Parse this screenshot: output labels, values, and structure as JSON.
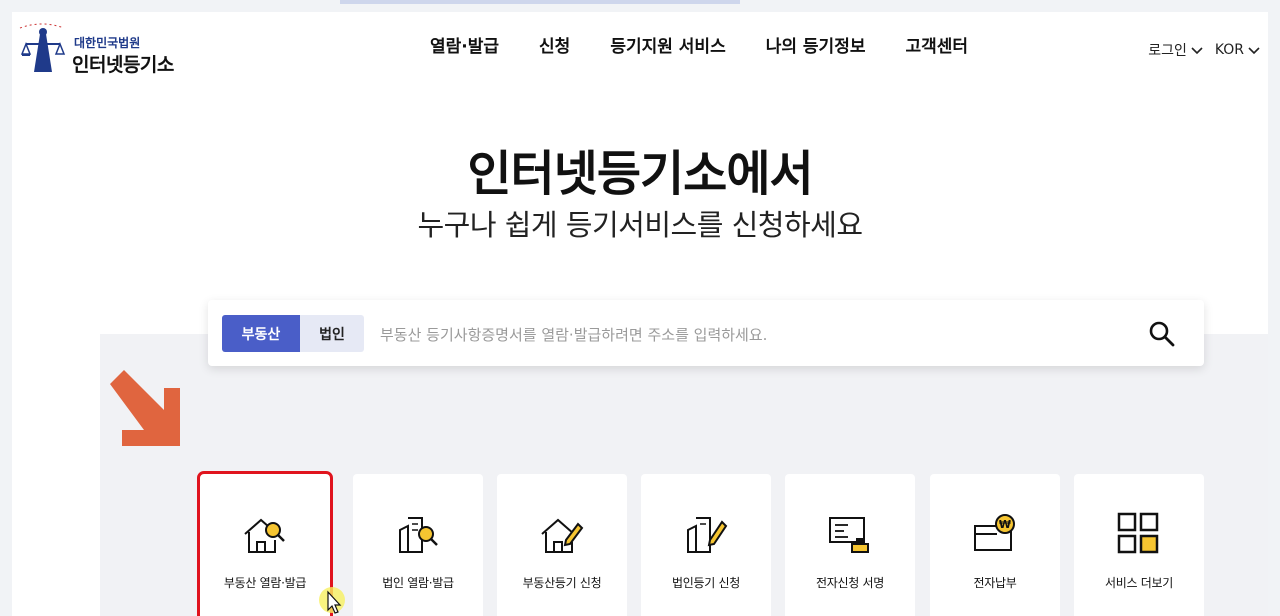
{
  "header": {
    "logo_sub": "대한민국법원",
    "logo_main": "인터넷등기소",
    "nav": [
      "열람·발급",
      "신청",
      "등기지원 서비스",
      "나의 등기정보",
      "고객센터"
    ],
    "login": "로그인",
    "language": "KOR"
  },
  "hero": {
    "title": "인터넷등기소에서",
    "subtitle": "누구나 쉽게 등기서비스를 신청하세요"
  },
  "search": {
    "tab_active": "부동산",
    "tab_inactive": "법인",
    "placeholder": "부동산 등기사항증명서를 열람·발급하려면 주소를 입력하세요."
  },
  "cards": [
    {
      "label": "부동산 열람·발급",
      "icon": "house-search-icon"
    },
    {
      "label": "법인 열람·발급",
      "icon": "building-search-icon"
    },
    {
      "label": "부동산등기 신청",
      "icon": "house-pen-icon"
    },
    {
      "label": "법인등기 신청",
      "icon": "building-pen-icon"
    },
    {
      "label": "전자신청 서명",
      "icon": "stamp-document-icon"
    },
    {
      "label": "전자납부",
      "icon": "card-won-icon"
    },
    {
      "label": "서비스 더보기",
      "icon": "grid-icon"
    }
  ],
  "colors": {
    "accent": "#4a5ec8",
    "highlight_yellow": "#f6c531",
    "annotation_red": "#e0141e",
    "annotation_arrow": "#e0653f"
  }
}
